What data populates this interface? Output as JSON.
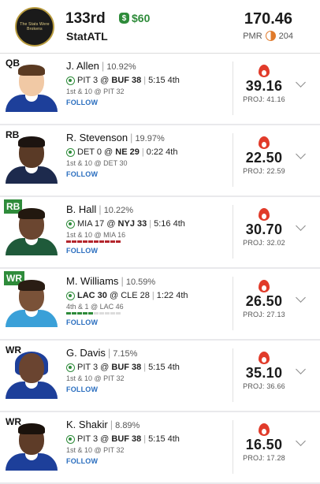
{
  "header": {
    "logo_text": "The Stats Were Brokens",
    "rank": "133rd",
    "money_icon": "$",
    "money": "$60",
    "team_name": "StatATL",
    "total_points": "170.46",
    "pmr_label": "PMR",
    "pmr_value": "204"
  },
  "colors": {
    "accent_green": "#2e8b3a",
    "follow_blue": "#2a6ebf",
    "fire_red": "#e13b2a",
    "pmr_orange": "#e07a2b"
  },
  "players": [
    {
      "position": "QB",
      "position_flag": false,
      "name": "J. Allen",
      "roster_pct": "10.92%",
      "game_away": "PIT 3",
      "game_at": "@",
      "game_home": "BUF 38",
      "bold_team": "home",
      "clock": "5:15 4th",
      "down": "1st & 10 @ PIT 32",
      "drive": [],
      "follow": "FOLLOW",
      "score": "39.16",
      "proj": "PROJ: 41.16"
    },
    {
      "position": "RB",
      "position_flag": false,
      "name": "R. Stevenson",
      "roster_pct": "19.97%",
      "game_away": "DET 0",
      "game_at": "@",
      "game_home": "NE 29",
      "bold_team": "home",
      "clock": "0:22 4th",
      "down": "1st & 10 @ DET 30",
      "drive": [],
      "follow": "FOLLOW",
      "score": "22.50",
      "proj": "PROJ: 22.59"
    },
    {
      "position": "RB",
      "position_flag": true,
      "name": "B. Hall",
      "roster_pct": "10.22%",
      "game_away": "MIA 17",
      "game_at": "@",
      "game_home": "NYJ 33",
      "bold_team": "home",
      "clock": "5:16 4th",
      "down": "1st & 10 @ MIA 16",
      "drive": [
        "#b4262d",
        "#b4262d",
        "#b4262d",
        "#b4262d",
        "#b4262d",
        "#b4262d",
        "#b4262d",
        "#b4262d",
        "#b4262d",
        "#b4262d"
      ],
      "follow": "FOLLOW",
      "score": "30.70",
      "proj": "PROJ: 32.02"
    },
    {
      "position": "WR",
      "position_flag": true,
      "name": "M. Williams",
      "roster_pct": "10.59%",
      "game_away": "LAC 30",
      "game_at": "@",
      "game_home": "CLE 28",
      "bold_team": "away",
      "clock": "1:22 4th",
      "down": "4th & 1 @ LAC 46",
      "drive": [
        "#2e8b3a",
        "#2e8b3a",
        "#2e8b3a",
        "#2e8b3a",
        "#2e8b3a",
        "#dcdcdc",
        "#dcdcdc",
        "#dcdcdc",
        "#dcdcdc",
        "#dcdcdc"
      ],
      "follow": "FOLLOW",
      "score": "26.50",
      "proj": "PROJ: 27.13"
    },
    {
      "position": "WR",
      "position_flag": false,
      "name": "G. Davis",
      "roster_pct": "7.15%",
      "game_away": "PIT 3",
      "game_at": "@",
      "game_home": "BUF 38",
      "bold_team": "home",
      "clock": "5:15 4th",
      "down": "1st & 10 @ PIT 32",
      "drive": [],
      "follow": "FOLLOW",
      "score": "35.10",
      "proj": "PROJ: 36.66"
    },
    {
      "position": "WR",
      "position_flag": false,
      "name": "K. Shakir",
      "roster_pct": "8.89%",
      "game_away": "PIT 3",
      "game_at": "@",
      "game_home": "BUF 38",
      "bold_team": "home",
      "clock": "5:15 4th",
      "down": "1st & 10 @ PIT 32",
      "drive": [],
      "follow": "FOLLOW",
      "score": "16.50",
      "proj": "PROJ: 17.28"
    }
  ]
}
